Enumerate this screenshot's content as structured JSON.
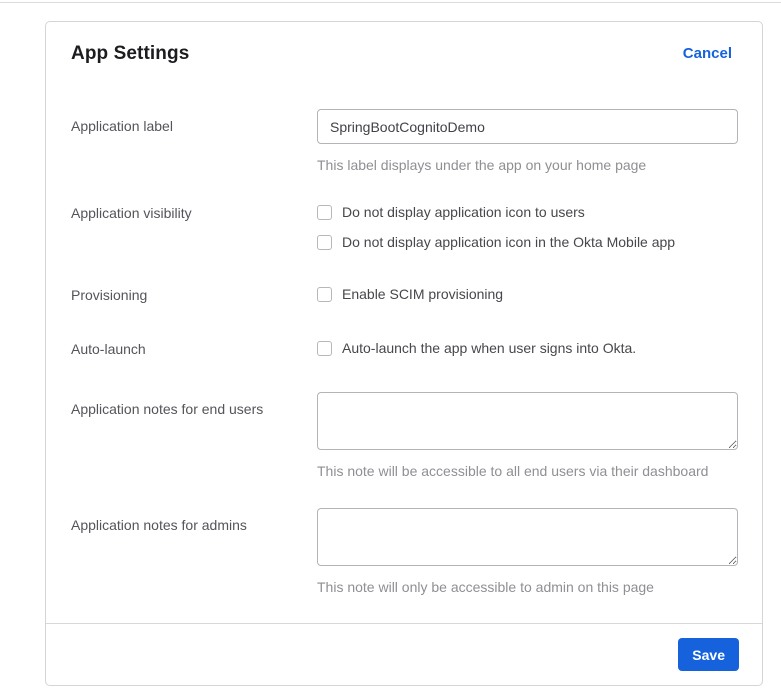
{
  "header": {
    "title": "App Settings",
    "cancel_label": "Cancel"
  },
  "form": {
    "application_label": {
      "label": "Application label",
      "value": "SpringBootCognitoDemo",
      "helper": "This label displays under the app on your home page"
    },
    "application_visibility": {
      "label": "Application visibility",
      "options": [
        {
          "label": "Do not display application icon to users",
          "checked": false
        },
        {
          "label": "Do not display application icon in the Okta Mobile app",
          "checked": false
        }
      ]
    },
    "provisioning": {
      "label": "Provisioning",
      "options": [
        {
          "label": "Enable SCIM provisioning",
          "checked": false
        }
      ]
    },
    "auto_launch": {
      "label": "Auto-launch",
      "options": [
        {
          "label": "Auto-launch the app when user signs into Okta.",
          "checked": false
        }
      ]
    },
    "notes_end_users": {
      "label": "Application notes for end users",
      "value": "",
      "helper": "This note will be accessible to all end users via their dashboard"
    },
    "notes_admins": {
      "label": "Application notes for admins",
      "value": "",
      "helper": "This note will only be accessible to admin on this page"
    }
  },
  "footer": {
    "save_label": "Save"
  },
  "colors": {
    "accent_blue": "#1662dd",
    "card_border": "#d5d5d9",
    "input_border": "#b3b3b8",
    "title_text": "#1d1d21",
    "label_text": "#54545a",
    "helper_text": "#8f8f94"
  }
}
